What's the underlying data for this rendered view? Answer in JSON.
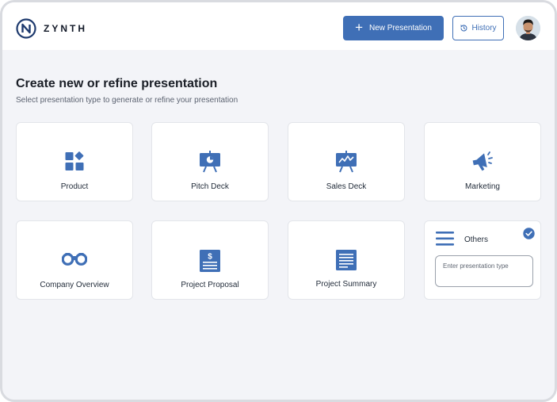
{
  "header": {
    "brand": "ZYNTH",
    "new_presentation_label": "New Presentation",
    "history_label": "History",
    "logo_icon": "brand-n-logo",
    "history_icon": "history-icon",
    "accent_color": "#3f6fb6"
  },
  "main": {
    "title": "Create new or refine presentation",
    "subtitle": "Select presentation type to generate or refine your presentation"
  },
  "cards": [
    {
      "label": "Product",
      "icon": "grid-shapes-icon"
    },
    {
      "label": "Pitch Deck",
      "icon": "presentation-board-icon"
    },
    {
      "label": "Sales Deck",
      "icon": "sales-chart-board-icon"
    },
    {
      "label": "Marketing",
      "icon": "megaphone-icon"
    },
    {
      "label": "Company Overview",
      "icon": "binoculars-icon"
    },
    {
      "label": "Project Proposal",
      "icon": "dollar-document-icon"
    },
    {
      "label": "Project Summary",
      "icon": "summary-document-icon"
    }
  ],
  "others": {
    "label": "Others",
    "input_placeholder": "Enter presentation type",
    "input_value": "",
    "selected": true
  }
}
